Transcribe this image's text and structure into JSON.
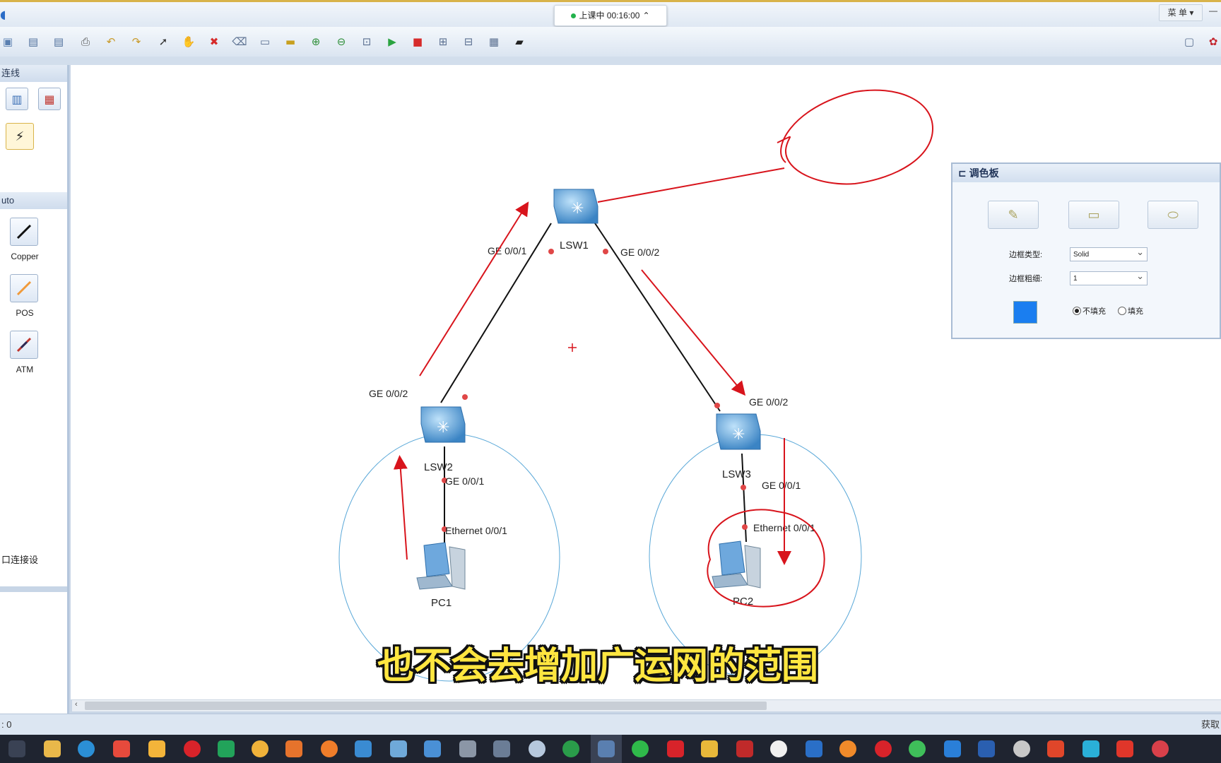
{
  "titlebar": {
    "recording_status": "上课中 00:16:00",
    "menu_label": "菜 单",
    "minimize_label": "—"
  },
  "sidebar": {
    "section1_header": "连线",
    "section2_header": "uto",
    "cables": [
      {
        "label": "Copper"
      },
      {
        "label": "POS"
      },
      {
        "label": "ATM"
      }
    ],
    "bottom_text": "口连接设"
  },
  "topology": {
    "devices": [
      {
        "name": "LSW1"
      },
      {
        "name": "LSW2"
      },
      {
        "name": "LSW3"
      },
      {
        "name": "PC1"
      },
      {
        "name": "PC2"
      }
    ],
    "ports": {
      "lsw1_left": "GE 0/0/1",
      "lsw1_right": "GE 0/0/2",
      "lsw2_up": "GE 0/0/2",
      "lsw2_down": "GE 0/0/1",
      "pc1_port": "Ethernet 0/0/1",
      "lsw3_up": "GE 0/0/2",
      "lsw3_down": "GE 0/0/1",
      "pc2_port": "Ethernet 0/0/1"
    }
  },
  "palette": {
    "title": "调色板",
    "border_type_label": "边框类型:",
    "border_type_value": "Solid",
    "border_width_label": "边框粗细:",
    "border_width_value": "1",
    "fill_color": "#1a7ef0",
    "no_fill_label": "不填充",
    "fill_label": "填充"
  },
  "statusbar": {
    "left_text": ": 0",
    "right_text": "获取"
  },
  "caption": "也不会去增加广运网的范围",
  "colors": {
    "annotation_red": "#d8141c",
    "circle_blue": "#5aa8d8",
    "link_black": "#111111"
  }
}
